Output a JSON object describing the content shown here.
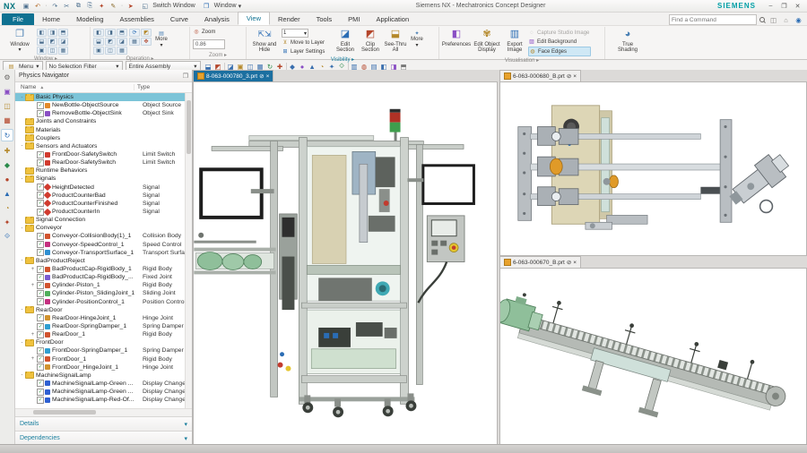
{
  "window": {
    "app": "NX",
    "title": "Siemens NX - Mechatronics Concept Designer",
    "brand": "SIEMENS",
    "minimize": "–",
    "restore": "❐",
    "close": "✕"
  },
  "qat": {
    "icons": [
      "save-icon",
      "undo-icon",
      "redo-icon",
      "cut-icon",
      "copy-icon",
      "paste-icon",
      "touch-icon",
      "repeat-icon",
      "command-finder-icon"
    ],
    "switch_window": "Switch Window",
    "window_menu": "Window"
  },
  "ribbon": {
    "tabs": [
      {
        "label": "File",
        "kind": "file"
      },
      {
        "label": "Home"
      },
      {
        "label": "Modeling"
      },
      {
        "label": "Assemblies"
      },
      {
        "label": "Curve"
      },
      {
        "label": "Analysis"
      },
      {
        "label": "View",
        "kind": "active"
      },
      {
        "label": "Render"
      },
      {
        "label": "Tools"
      },
      {
        "label": "PMI"
      },
      {
        "label": "Application"
      }
    ],
    "find_placeholder": "Find a Command",
    "groups": {
      "window": "Window",
      "operation": "Operation",
      "zoom": "Zoom",
      "visibility": "Visibility",
      "visualization": "Visualisation"
    },
    "buttons": {
      "window": "Window",
      "more": "More",
      "zoom": "Zoom",
      "zoom_value": "0.86",
      "show_hide": "Show and Hide",
      "layer_value": "1",
      "move_to_layer": "Move to Layer",
      "layer_settings": "Layer Settings",
      "edit_section": "Edit Section",
      "clip_section": "Clip Section",
      "see_thru": "See-Thru All",
      "preferences": "Preferences",
      "edit_object_display": "Edit Object Display",
      "export_image": "Export Image",
      "capture_studio": "Capture Studio Image",
      "edit_background": "Edit Background",
      "face_edges": "Face Edges",
      "true_shading": "True Shading"
    },
    "window_grid_icons": [
      "cascade-icon",
      "tile-horizontal-icon",
      "tile-vertical-icon",
      "split-left-icon",
      "split-right-icon",
      "split-top-icon",
      "split-bottom-icon",
      "float-window-icon",
      "restore-window-icon"
    ],
    "operation_icons": [
      "fit-view-icon",
      "orient-view-icon",
      "trimetric-icon",
      "pan-icon",
      "rotate-view-icon",
      "perspective-icon",
      "refresh-icon",
      "render-style-icon",
      "snapshot-icon"
    ]
  },
  "toolbar": {
    "menu": "Menu",
    "selection_filter": "No Selection Filter",
    "scope": "Entire Assembly",
    "icons": [
      "reset-icon",
      "undo-icon",
      "select-box-icon",
      "highlight-icon",
      "snap-point-icon",
      "point-icon",
      "line-icon",
      "arc-icon",
      "datum-icon",
      "sphere-icon",
      "shaded-icon",
      "wireframe-icon",
      "edges-icon",
      "layers-icon",
      "move-icon",
      "rotate-icon",
      "pattern-icon",
      "measure-icon",
      "markup-icon",
      "more-icon"
    ]
  },
  "resource_bar": {
    "icons": [
      "gear-icon",
      "roles-icon",
      "assembly-navigator-icon",
      "constraint-navigator-icon",
      "physics-navigator-icon",
      "sequence-editor-icon",
      "folders-icon",
      "history-icon",
      "materials-icon",
      "palette-icon",
      "clock-icon",
      "globe-icon"
    ]
  },
  "navigator": {
    "title": "Physics Navigator",
    "columns": [
      "Name",
      "Type"
    ],
    "sort_arrow": "▲",
    "details": "Details",
    "dependencies": "Dependencies",
    "rows": [
      {
        "d": 0,
        "k": "folder",
        "e": "-",
        "n": "Basic Physics",
        "t": "",
        "sel": true
      },
      {
        "d": 1,
        "k": "item",
        "ic": "source",
        "n": "NewBottle-ObjectSource",
        "t": "Object Source"
      },
      {
        "d": 1,
        "k": "item",
        "ic": "sink",
        "n": "RemoveBottle-ObjectSink",
        "t": "Object Sink"
      },
      {
        "d": 0,
        "k": "folder",
        "e": "",
        "n": "Joints and Constraints",
        "t": ""
      },
      {
        "d": 0,
        "k": "folder",
        "e": "",
        "n": "Materials",
        "t": ""
      },
      {
        "d": 0,
        "k": "folder",
        "e": "",
        "n": "Couplers",
        "t": ""
      },
      {
        "d": 0,
        "k": "folder",
        "e": "-",
        "n": "Sensors and Actuators",
        "t": ""
      },
      {
        "d": 1,
        "k": "item",
        "ic": "switch",
        "n": "FrontDoor-SafetySwitch",
        "t": "Limit Switch"
      },
      {
        "d": 1,
        "k": "item",
        "ic": "switch",
        "n": "RearDoor-SafetySwitch",
        "t": "Limit Switch"
      },
      {
        "d": 0,
        "k": "folder",
        "e": "",
        "n": "Runtime Behaviors",
        "t": ""
      },
      {
        "d": 0,
        "k": "folder",
        "e": "-",
        "n": "Signals",
        "t": ""
      },
      {
        "d": 1,
        "k": "item",
        "ic": "signal",
        "n": "HeightDetected",
        "t": "Signal"
      },
      {
        "d": 1,
        "k": "item",
        "ic": "signal",
        "n": "ProductCounterBad",
        "t": "Signal"
      },
      {
        "d": 1,
        "k": "item",
        "ic": "signal",
        "n": "ProductCounterFinished",
        "t": "Signal"
      },
      {
        "d": 1,
        "k": "item",
        "ic": "signal",
        "n": "ProductCounterIn",
        "t": "Signal"
      },
      {
        "d": 0,
        "k": "folder",
        "e": "",
        "n": "Signal Connection",
        "t": ""
      },
      {
        "d": 0,
        "k": "folder",
        "e": "-",
        "n": "Conveyor",
        "t": ""
      },
      {
        "d": 1,
        "k": "item",
        "ic": "body",
        "n": "Conveyor-CollisionBody(1)_1",
        "t": "Collision Body"
      },
      {
        "d": 1,
        "k": "item",
        "ic": "control",
        "n": "Conveyor-SpeedControl_1",
        "t": "Speed Control"
      },
      {
        "d": 1,
        "k": "item",
        "ic": "surface",
        "n": "Conveyor-TransportSurface_1",
        "t": "Transport Surface"
      },
      {
        "d": 0,
        "k": "folder",
        "e": "-",
        "n": "BadProductReject",
        "t": ""
      },
      {
        "d": 1,
        "k": "item",
        "ic": "body",
        "e": "+",
        "n": "BadProductCap-RigidBody_1",
        "t": "Rigid Body"
      },
      {
        "d": 1,
        "k": "item",
        "ic": "joint",
        "n": "BadProductCap-RigidBody_...",
        "t": "Fixed Joint"
      },
      {
        "d": 1,
        "k": "item",
        "ic": "body",
        "e": "+",
        "n": "Cylinder-Piston_1",
        "t": "Rigid Body"
      },
      {
        "d": 1,
        "k": "item",
        "ic": "sliding",
        "n": "Cylinder-Piston_SlidingJoint_1",
        "t": "Sliding Joint"
      },
      {
        "d": 1,
        "k": "item",
        "ic": "control",
        "n": "Cylinder-PositionControl_1",
        "t": "Position Control"
      },
      {
        "d": 0,
        "k": "folder",
        "e": "-",
        "n": "RearDoor",
        "t": ""
      },
      {
        "d": 1,
        "k": "item",
        "ic": "hinge",
        "n": "RearDoor-HingeJoint_1",
        "t": "Hinge Joint"
      },
      {
        "d": 1,
        "k": "item",
        "ic": "damper",
        "n": "RearDoor-SpringDamper_1",
        "t": "Spring Damper"
      },
      {
        "d": 1,
        "k": "item",
        "ic": "body",
        "e": "+",
        "n": "RearDoor_1",
        "t": "Rigid Body"
      },
      {
        "d": 0,
        "k": "folder",
        "e": "-",
        "n": "FrontDoor",
        "t": ""
      },
      {
        "d": 1,
        "k": "item",
        "ic": "damper",
        "n": "FrontDoor-SpringDamper_1",
        "t": "Spring Damper"
      },
      {
        "d": 1,
        "k": "item",
        "ic": "body",
        "e": "+",
        "n": "FrontDoor_1",
        "t": "Rigid Body"
      },
      {
        "d": 1,
        "k": "item",
        "ic": "hinge",
        "n": "FrontDoor_HingeJoint_1",
        "t": "Hinge Joint"
      },
      {
        "d": 0,
        "k": "folder",
        "e": "-",
        "n": "MachineSignalLamp",
        "t": ""
      },
      {
        "d": 1,
        "k": "item",
        "ic": "display",
        "n": "MachineSignalLamp-Green ...",
        "t": "Display Changer"
      },
      {
        "d": 1,
        "k": "item",
        "ic": "display",
        "n": "MachineSignalLamp-Green ...",
        "t": "Display Changer"
      },
      {
        "d": 1,
        "k": "item",
        "ic": "display",
        "n": "MachineSignalLamp-Red-Of...",
        "t": "Display Changer"
      }
    ]
  },
  "viewports": {
    "main": {
      "tab": "8-063-000780_3.prt",
      "pin": "⊘",
      "close": "×"
    },
    "top_right": {
      "tab": "6-063-000680_B.prt",
      "pin": "⊘",
      "close": "×"
    },
    "bottom_right": {
      "tab": "6-063-000670_B.prt",
      "pin": "⊘",
      "close": "×"
    }
  },
  "colors": {
    "accent_teal": "#0f7191",
    "brand_teal": "#009fa6",
    "selection_blue": "#7cc4d8",
    "active_tab_blue": "#1b6fa0",
    "lamp_red": "#b03226",
    "lamp_green": "#3f9e4d",
    "motor_green": "#8fbf9a",
    "panel_beige": "#d8d1b2"
  }
}
